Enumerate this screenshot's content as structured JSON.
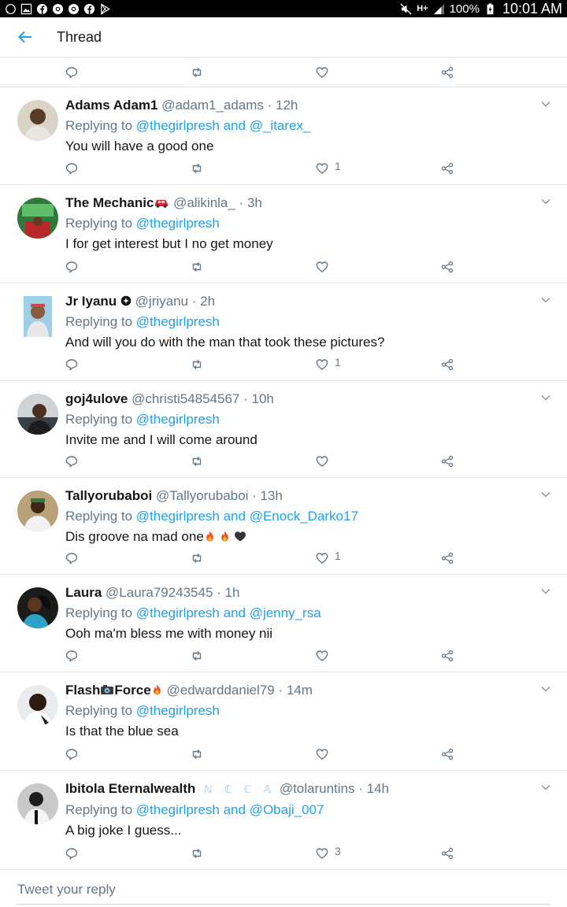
{
  "status_bar": {
    "battery": "100%",
    "time": "10:01 AM",
    "network": "H+",
    "left_icons": [
      "whatsapp-icon",
      "gallery-icon",
      "facebook-icon",
      "chrome-icon",
      "chrome-icon",
      "facebook-icon",
      "play-store-icon"
    ]
  },
  "header": {
    "title": "Thread",
    "accent": "#1da1f2"
  },
  "top_actions": {
    "like_count": ""
  },
  "tweets": [
    {
      "name": "Adams Adam1",
      "handle": "@adam1_adams · 12h",
      "replying_prefix": "Replying to ",
      "mention1": "@thegirlpresh",
      "connector": " and ",
      "mention2": "@_itarex_",
      "text": "You will have a good one",
      "like_count": "1"
    },
    {
      "name": "The Mechanic",
      "handle": "@alikinla_ · 3h",
      "replying_prefix": "Replying to ",
      "mention1": "@thegirlpresh",
      "text": "I for get interest but I no get money",
      "like_count": ""
    },
    {
      "name": "Jr Iyanu",
      "handle": "@jriyanu · 2h",
      "replying_prefix": "Replying to ",
      "mention1": "@thegirlpresh",
      "text": "And will you do with the man that took these pictures?",
      "like_count": "1"
    },
    {
      "name": "goj4ulove",
      "handle": "@christi54854567 · 10h",
      "replying_prefix": "Replying to ",
      "mention1": "@thegirlpresh",
      "text": "Invite me and I will come around",
      "like_count": ""
    },
    {
      "name": "Tallyorubaboi",
      "handle": "@Tallyorubaboi · 13h",
      "replying_prefix": "Replying to ",
      "mention1": "@thegirlpresh",
      "connector": " and ",
      "mention2": "@Enock_Darko17",
      "text": "Dis groove na mad one",
      "like_count": "1"
    },
    {
      "name": "Laura",
      "handle": "@Laura79243545 · 1h",
      "replying_prefix": "Replying to ",
      "mention1": "@thegirlpresh",
      "connector": " and ",
      "mention2": "@jenny_rsa",
      "text": "Ooh ma'm bless me with money nii",
      "like_count": ""
    },
    {
      "name_part1": "Flash",
      "name_part2": "Force",
      "handle": "@edwarddaniel79 · 14m",
      "replying_prefix": "Replying to ",
      "mention1": "@thegirlpresh",
      "text": "Is that the blue sea",
      "like_count": ""
    },
    {
      "name": "Ibitola Eternalwealth",
      "name_extra": "ℕ ℂ ℂ 𝔸",
      "handle": "@tolaruntins · 14h",
      "replying_prefix": "Replying to ",
      "mention1": "@thegirlpresh",
      "connector": " and ",
      "mention2": "@Obaji_007",
      "text": "A big joke I guess...",
      "like_count": "3"
    }
  ],
  "composer": {
    "placeholder": "Tweet your reply"
  }
}
